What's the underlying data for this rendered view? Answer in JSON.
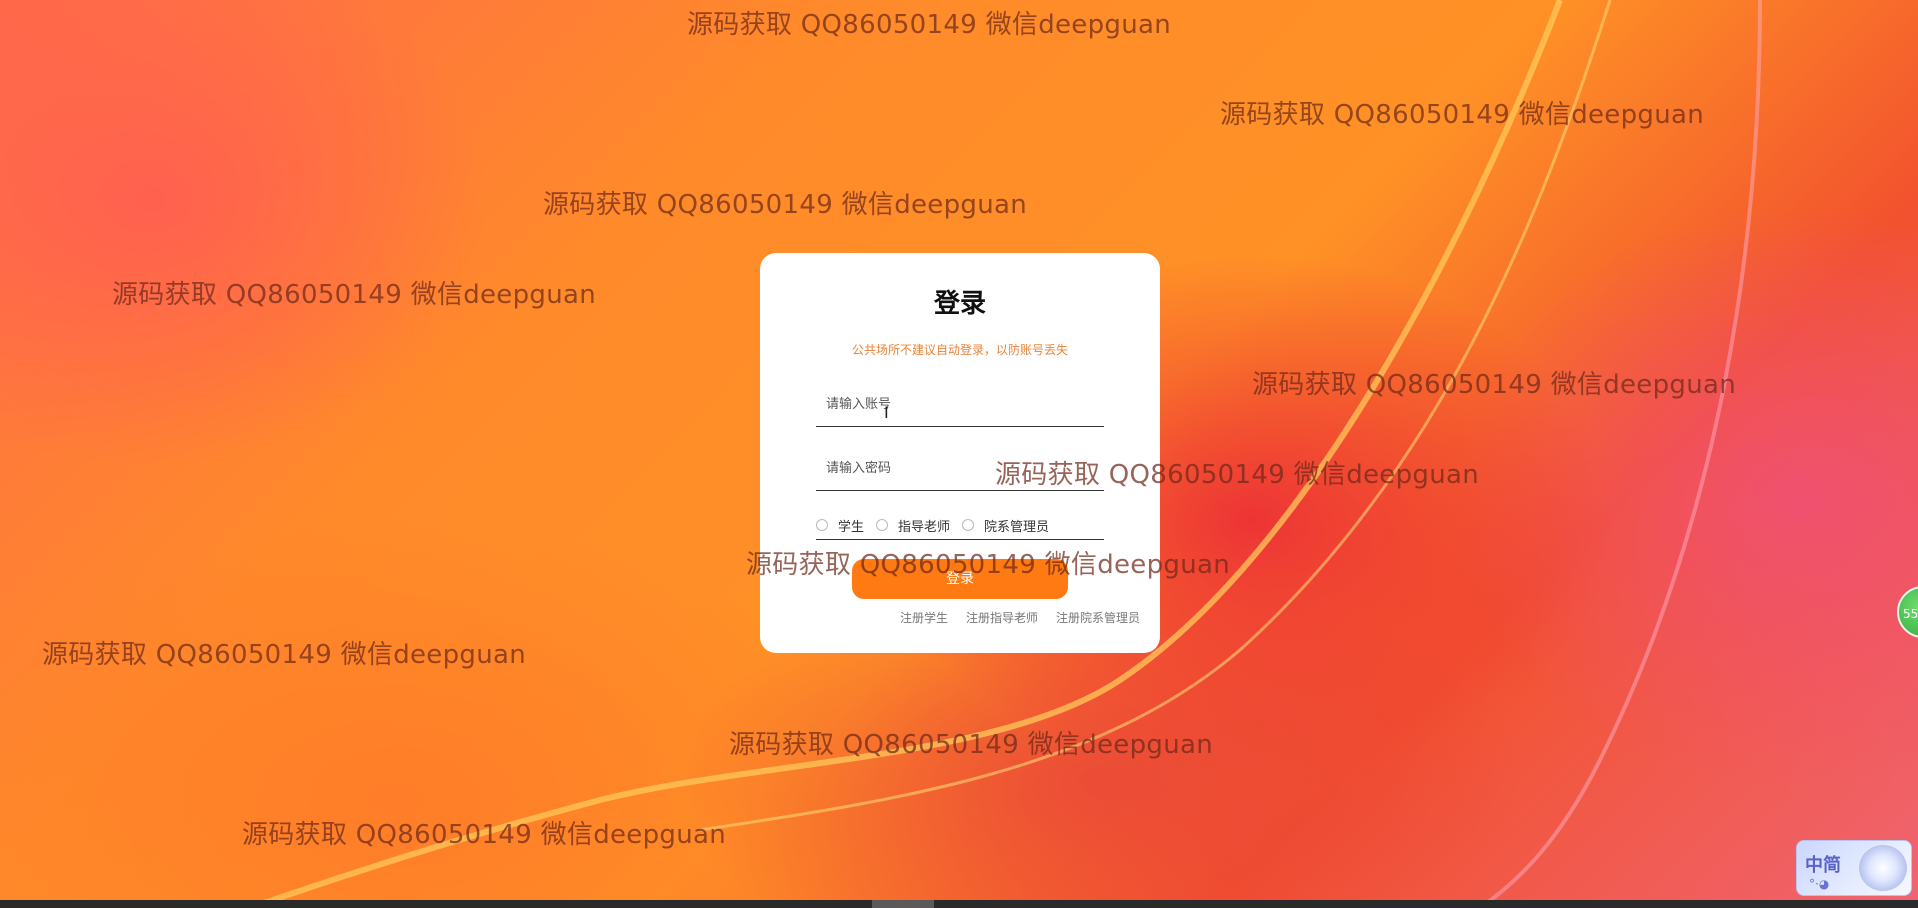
{
  "login": {
    "title": "登录",
    "hint": "公共场所不建议自动登录，以防账号丢失",
    "account_placeholder": "请输入账号",
    "password_placeholder": "请输入密码",
    "roles": [
      "学生",
      "指导老师",
      "院系管理员"
    ],
    "submit_label": "登录",
    "register_links": [
      "注册学生",
      "注册指导老师",
      "注册院系管理员"
    ]
  },
  "watermark": {
    "text": "源码获取 QQ86050149 微信deepguan"
  },
  "side_badge": {
    "text": "55"
  },
  "ime": {
    "text": "中简"
  },
  "colors": {
    "accent": "#ff7a12",
    "hint": "#e8833a",
    "card": "#ffffff"
  }
}
